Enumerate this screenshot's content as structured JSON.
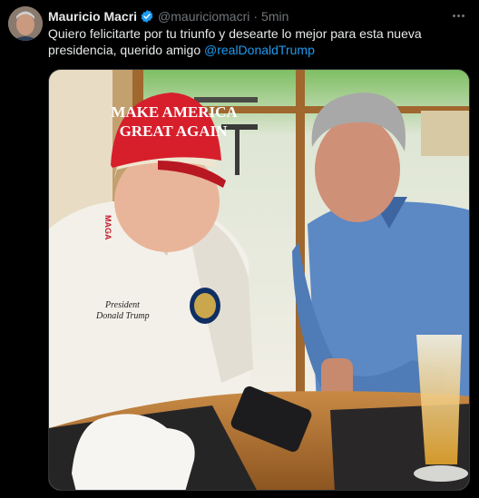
{
  "author": {
    "display_name": "Mauricio Macri",
    "handle": "@mauriciomacri",
    "separator": "·",
    "time": "5min",
    "verified": true,
    "avatar_icon": "profile-photo-avatar",
    "verified_icon": "verified-badge-icon"
  },
  "tweet": {
    "text": "Quiero felicitarte por tu triunfo y desearte lo mejor para esta nueva presidencia, querido amigo ",
    "mention": "@realDonaldTrump"
  },
  "media": {
    "cap_line1": "MAKE AMERICA",
    "cap_line2": "GREAT AGAIN",
    "cap_side": "MAGA",
    "shirt_line1": "President",
    "shirt_line2": "Donald Trump"
  },
  "colors": {
    "background": "#000000",
    "text_primary": "#e7e9ea",
    "text_secondary": "#71767b",
    "link": "#1d9bf0",
    "verified": "#1d9bf0"
  }
}
